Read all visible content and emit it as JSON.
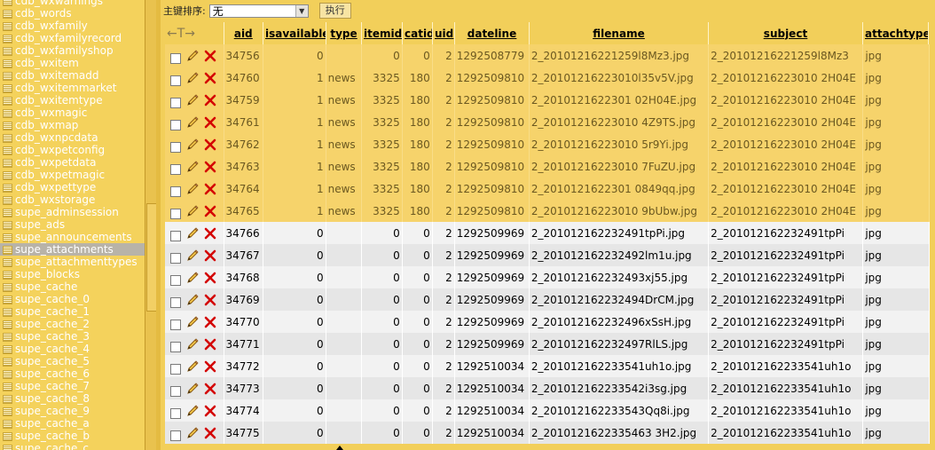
{
  "sidebar": {
    "tables": [
      "cdb_wxwarnings",
      "cdb_words",
      "cdb_wxfamily",
      "cdb_wxfamilyrecord",
      "cdb_wxfamilyshop",
      "cdb_wxitem",
      "cdb_wxitemadd",
      "cdb_wxitemmarket",
      "cdb_wxitemtype",
      "cdb_wxmagic",
      "cdb_wxmap",
      "cdb_wxnpcdata",
      "cdb_wxpetconfig",
      "cdb_wxpetdata",
      "cdb_wxpetmagic",
      "cdb_wxpettype",
      "cdb_wxstorage",
      "supe_adminsession",
      "supe_ads",
      "supe_announcements",
      "supe_attachments",
      "supe_attachmenttypes",
      "supe_blocks",
      "supe_cache",
      "supe_cache_0",
      "supe_cache_1",
      "supe_cache_2",
      "supe_cache_3",
      "supe_cache_4",
      "supe_cache_5",
      "supe_cache_6",
      "supe_cache_7",
      "supe_cache_8",
      "supe_cache_9",
      "supe_cache_a",
      "supe_cache_b",
      "supe_cache_c"
    ],
    "active_index": 20
  },
  "sortbar": {
    "label": "主键排序:",
    "selected": "无",
    "exec_label": "执行"
  },
  "grid": {
    "nav_arrows": "←T→",
    "columns": [
      "aid",
      "isavailable",
      "type",
      "itemid",
      "catid",
      "uid",
      "dateline",
      "filename",
      "subject",
      "attachtype"
    ],
    "rows": [
      {
        "aid": "34756",
        "isavailable": "0",
        "type": "",
        "itemid": "0",
        "catid": "0",
        "uid": "2",
        "dateline": "1292508779",
        "filename": "2_20101216221259l8Mz3.jpg",
        "subject": "2_20101216221259l8Mz3",
        "attachtype": "jpg",
        "selected": true
      },
      {
        "aid": "34760",
        "isavailable": "1",
        "type": "news",
        "itemid": "3325",
        "catid": "180",
        "uid": "2",
        "dateline": "1292509810",
        "filename": "2_20101216223010l35v5V.jpg",
        "subject": "2_20101216223010 2H04E",
        "attachtype": "jpg",
        "selected": true
      },
      {
        "aid": "34759",
        "isavailable": "1",
        "type": "news",
        "itemid": "3325",
        "catid": "180",
        "uid": "2",
        "dateline": "1292509810",
        "filename": "2_2010121622301 02H04E.jpg",
        "subject": "2_20101216223010 2H04E",
        "attachtype": "jpg",
        "selected": true
      },
      {
        "aid": "34761",
        "isavailable": "1",
        "type": "news",
        "itemid": "3325",
        "catid": "180",
        "uid": "2",
        "dateline": "1292509810",
        "filename": "2_20101216223010 4Z9TS.jpg",
        "subject": "2_20101216223010 2H04E",
        "attachtype": "jpg",
        "selected": true
      },
      {
        "aid": "34762",
        "isavailable": "1",
        "type": "news",
        "itemid": "3325",
        "catid": "180",
        "uid": "2",
        "dateline": "1292509810",
        "filename": "2_20101216223010 5r9Yi.jpg",
        "subject": "2_20101216223010 2H04E",
        "attachtype": "jpg",
        "selected": true
      },
      {
        "aid": "34763",
        "isavailable": "1",
        "type": "news",
        "itemid": "3325",
        "catid": "180",
        "uid": "2",
        "dateline": "1292509810",
        "filename": "2_20101216223010 7FuZU.jpg",
        "subject": "2_20101216223010 2H04E",
        "attachtype": "jpg",
        "selected": true
      },
      {
        "aid": "34764",
        "isavailable": "1",
        "type": "news",
        "itemid": "3325",
        "catid": "180",
        "uid": "2",
        "dateline": "1292509810",
        "filename": "2_2010121622301 0849qq.jpg",
        "subject": "2_20101216223010 2H04E",
        "attachtype": "jpg",
        "selected": true
      },
      {
        "aid": "34765",
        "isavailable": "1",
        "type": "news",
        "itemid": "3325",
        "catid": "180",
        "uid": "2",
        "dateline": "1292509810",
        "filename": "2_20101216223010 9bUbw.jpg",
        "subject": "2_20101216223010 2H04E",
        "attachtype": "jpg",
        "selected": true
      },
      {
        "aid": "34766",
        "isavailable": "0",
        "type": "",
        "itemid": "0",
        "catid": "0",
        "uid": "2",
        "dateline": "1292509969",
        "filename": "2_201012162232491tpPi.jpg",
        "subject": "2_201012162232491tpPi",
        "attachtype": "jpg",
        "selected": false
      },
      {
        "aid": "34767",
        "isavailable": "0",
        "type": "",
        "itemid": "0",
        "catid": "0",
        "uid": "2",
        "dateline": "1292509969",
        "filename": "2_201012162232492lm1u.jpg",
        "subject": "2_201012162232491tpPi",
        "attachtype": "jpg",
        "selected": false
      },
      {
        "aid": "34768",
        "isavailable": "0",
        "type": "",
        "itemid": "0",
        "catid": "0",
        "uid": "2",
        "dateline": "1292509969",
        "filename": "2_201012162232493xj55.jpg",
        "subject": "2_201012162232491tpPi",
        "attachtype": "jpg",
        "selected": false
      },
      {
        "aid": "34769",
        "isavailable": "0",
        "type": "",
        "itemid": "0",
        "catid": "0",
        "uid": "2",
        "dateline": "1292509969",
        "filename": "2_201012162232494DrCM.jpg",
        "subject": "2_201012162232491tpPi",
        "attachtype": "jpg",
        "selected": false
      },
      {
        "aid": "34770",
        "isavailable": "0",
        "type": "",
        "itemid": "0",
        "catid": "0",
        "uid": "2",
        "dateline": "1292509969",
        "filename": "2_201012162232496xSsH.jpg",
        "subject": "2_201012162232491tpPi",
        "attachtype": "jpg",
        "selected": false
      },
      {
        "aid": "34771",
        "isavailable": "0",
        "type": "",
        "itemid": "0",
        "catid": "0",
        "uid": "2",
        "dateline": "1292509969",
        "filename": "2_201012162232497RlLS.jpg",
        "subject": "2_201012162232491tpPi",
        "attachtype": "jpg",
        "selected": false
      },
      {
        "aid": "34772",
        "isavailable": "0",
        "type": "",
        "itemid": "0",
        "catid": "0",
        "uid": "2",
        "dateline": "1292510034",
        "filename": "2_201012162233541uh1o.jpg",
        "subject": "2_201012162233541uh1o",
        "attachtype": "jpg",
        "selected": false
      },
      {
        "aid": "34773",
        "isavailable": "0",
        "type": "",
        "itemid": "0",
        "catid": "0",
        "uid": "2",
        "dateline": "1292510034",
        "filename": "2_201012162233542i3sg.jpg",
        "subject": "2_201012162233541uh1o",
        "attachtype": "jpg",
        "selected": false
      },
      {
        "aid": "34774",
        "isavailable": "0",
        "type": "",
        "itemid": "0",
        "catid": "0",
        "uid": "2",
        "dateline": "1292510034",
        "filename": "2_201012162233543Qq8i.jpg",
        "subject": "2_201012162233541uh1o",
        "attachtype": "jpg",
        "selected": false
      },
      {
        "aid": "34775",
        "isavailable": "0",
        "type": "",
        "itemid": "0",
        "catid": "0",
        "uid": "2",
        "dateline": "1292510034",
        "filename": "2_2010121622335463 3H2.jpg",
        "subject": "2_201012162233541uh1o",
        "attachtype": "jpg",
        "selected": false
      }
    ]
  },
  "colors": {
    "selected_row": "#f6d36b",
    "sidebar": "#f4d25c",
    "delete": "#d40000"
  }
}
